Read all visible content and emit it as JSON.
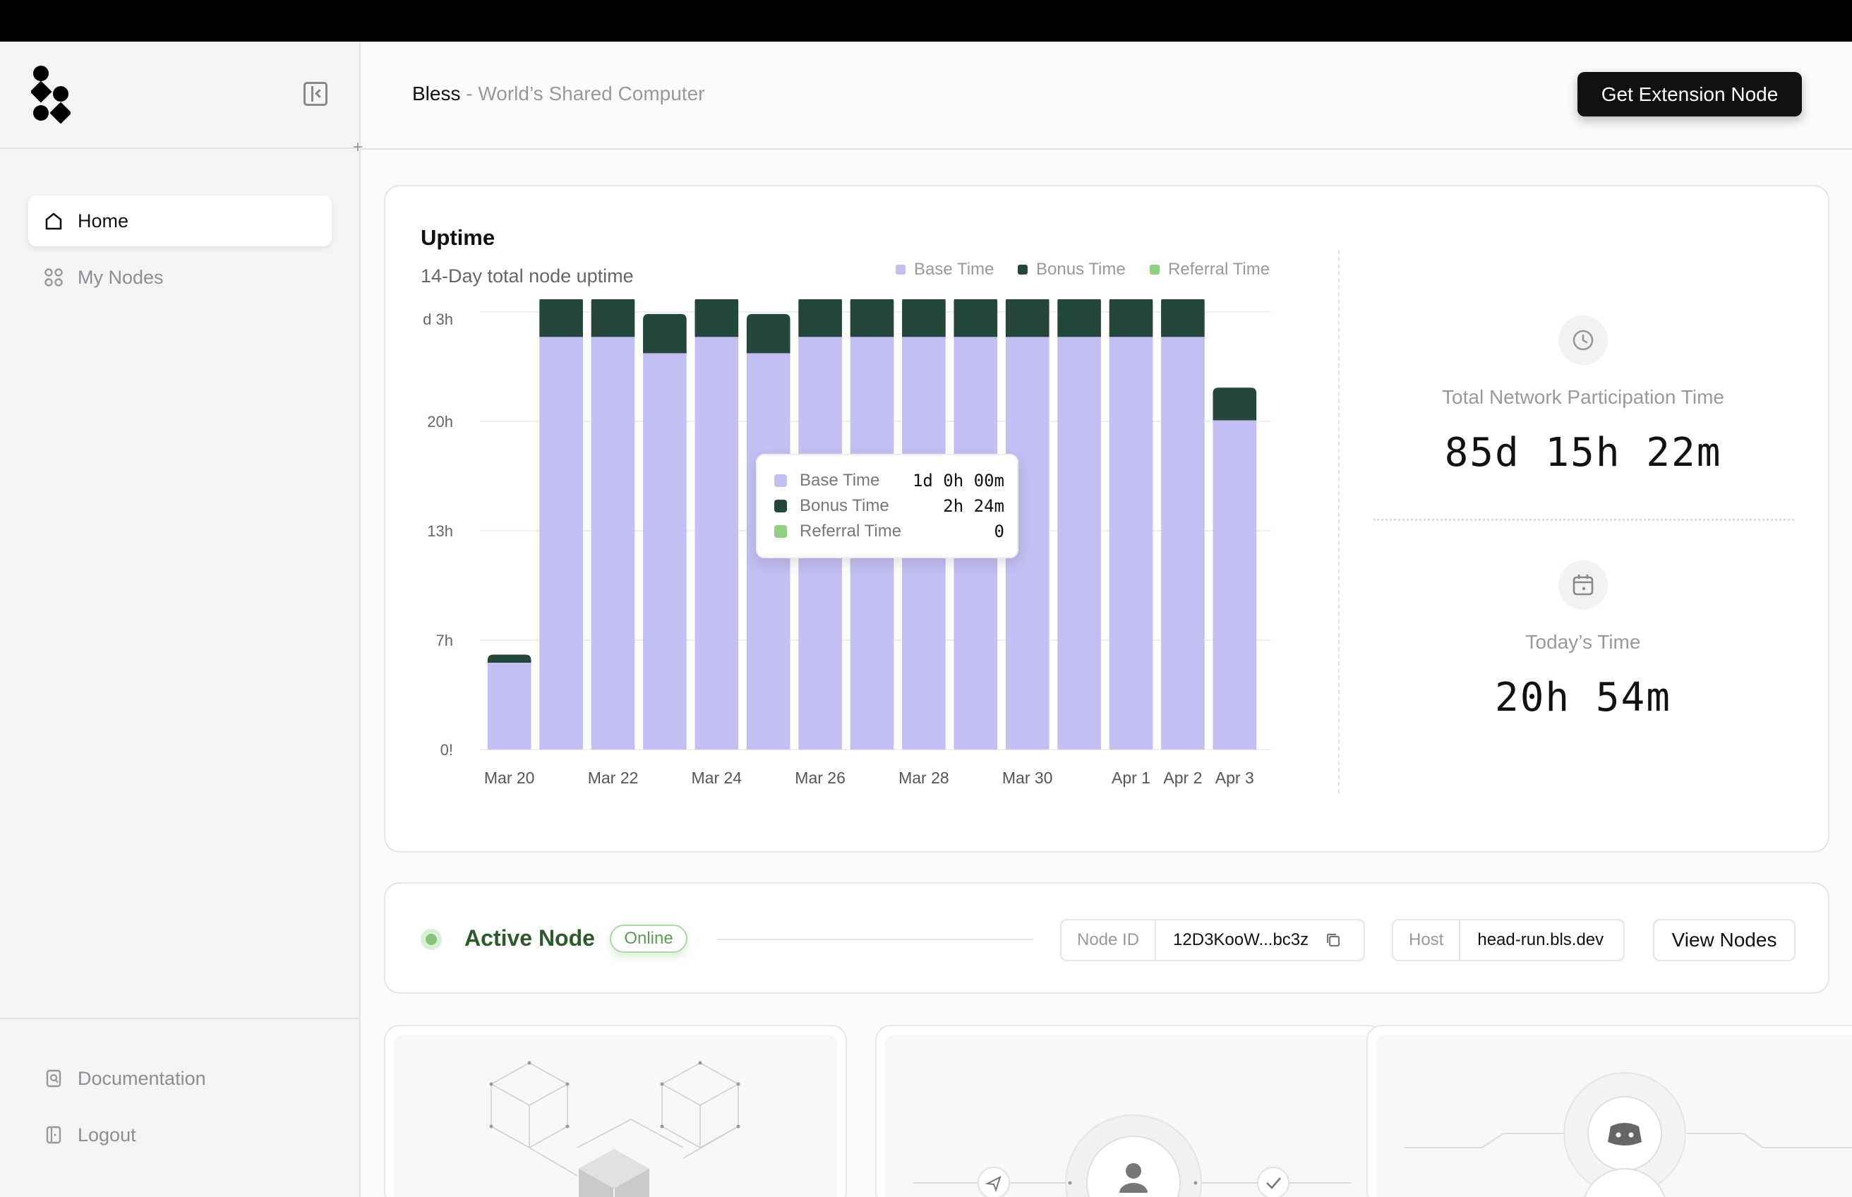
{
  "sidebar": {
    "nav": [
      {
        "label": "Home",
        "icon": "home-icon"
      },
      {
        "label": "My Nodes",
        "icon": "nodes-icon"
      }
    ],
    "bottom": [
      {
        "label": "Documentation",
        "icon": "document-search-icon"
      },
      {
        "label": "Logout",
        "icon": "logout-icon"
      }
    ]
  },
  "header": {
    "brand": "Bless",
    "subtitle": " - World’s Shared Computer",
    "cta": "Get Extension Node"
  },
  "uptime": {
    "title": "Uptime",
    "subtitle": "14-Day total node uptime",
    "stats": {
      "total_label": "Total Network Participation Time",
      "total_value": "85d 15h 22m",
      "today_label": "Today’s Time",
      "today_value": "20h 54m"
    },
    "tooltip": {
      "rows": [
        {
          "label": "Base Time",
          "value": "1d 0h 00m"
        },
        {
          "label": "Bonus Time",
          "value": "2h 24m"
        },
        {
          "label": "Referral Time",
          "value": "0"
        }
      ]
    }
  },
  "chart_data": {
    "type": "bar",
    "stacked": true,
    "categories": [
      "Mar 20",
      "Mar 21",
      "Mar 22",
      "Mar 23",
      "Mar 24",
      "Mar 25",
      "Mar 26",
      "Mar 27",
      "Mar 28",
      "Mar 29",
      "Mar 30",
      "Mar 31",
      "Apr 1",
      "Apr 2",
      "Apr 3"
    ],
    "x_tick_labels": [
      "Mar 20",
      "",
      "Mar 22",
      "",
      "Mar 24",
      "",
      "Mar 26",
      "",
      "Mar 28",
      "",
      "Mar 30",
      "",
      "Apr 1",
      "Apr 2",
      "Apr 3"
    ],
    "y_tick_labels": [
      "0!",
      "7h",
      "13h",
      "20h",
      "d 3h"
    ],
    "y_unit": "hours",
    "ylim": [
      0,
      27.5
    ],
    "series": [
      {
        "name": "Base Time",
        "color": "#c4bff3",
        "values": [
          5.3,
          25.2,
          25.2,
          24.2,
          25.2,
          24.2,
          25.2,
          25.2,
          25.2,
          25.2,
          25.2,
          25.2,
          25.2,
          25.2,
          20.1
        ]
      },
      {
        "name": "Bonus Time",
        "color": "#24463c",
        "values": [
          0.5,
          2.5,
          2.5,
          2.4,
          2.5,
          2.4,
          2.5,
          2.5,
          2.5,
          2.5,
          2.5,
          2.5,
          2.5,
          2.5,
          2.0
        ]
      },
      {
        "name": "Referral Time",
        "color": "#8fcf80",
        "values": [
          0,
          0,
          0,
          0,
          0,
          0,
          0,
          0,
          0,
          0,
          0,
          0,
          0,
          0,
          0
        ]
      }
    ],
    "legend_position": "top-right",
    "grid": true
  },
  "active_node": {
    "title": "Active Node",
    "status": "Online",
    "node_id_label": "Node ID",
    "node_id": "12D3KooW...bc3z",
    "host_label": "Host",
    "host": "head-run.bls.dev",
    "view_button": "View Nodes"
  },
  "colors": {
    "accent_dark": "#111111",
    "online_green": "#86c47a"
  }
}
